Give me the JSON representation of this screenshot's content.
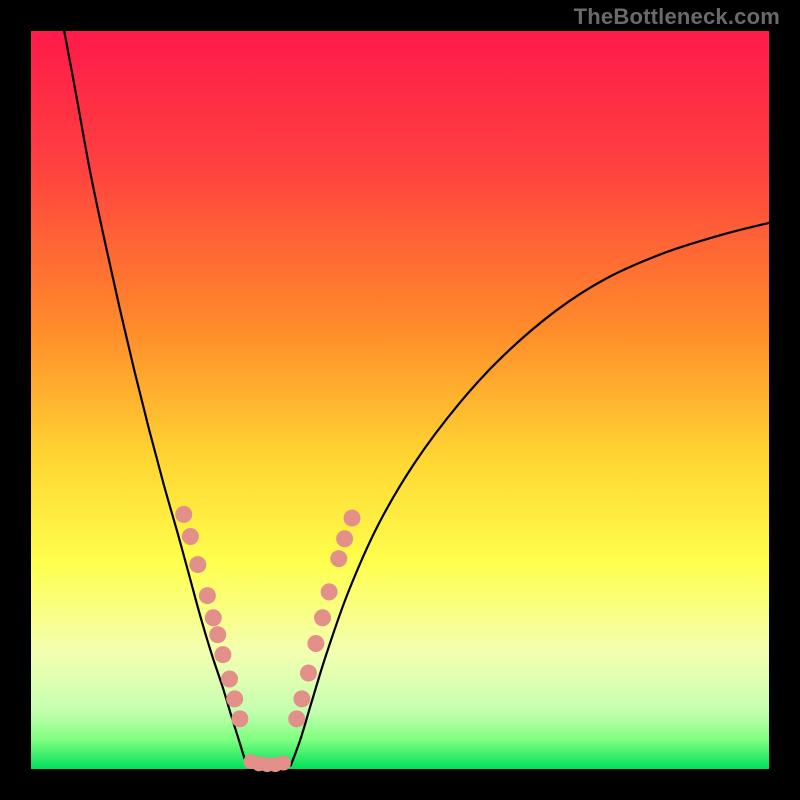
{
  "watermark": "TheBottleneck.com",
  "colors": {
    "frame": "#000000",
    "gradient_stops": [
      {
        "pct": 0,
        "color": "#ff1a4a"
      },
      {
        "pct": 18,
        "color": "#ff4040"
      },
      {
        "pct": 40,
        "color": "#ff8a2a"
      },
      {
        "pct": 58,
        "color": "#ffd633"
      },
      {
        "pct": 72,
        "color": "#ffff4d"
      },
      {
        "pct": 84,
        "color": "#f4ffb0"
      },
      {
        "pct": 92,
        "color": "#c6ffb0"
      },
      {
        "pct": 96,
        "color": "#80ff80"
      },
      {
        "pct": 100,
        "color": "#00e05a"
      }
    ],
    "curve": "#000000",
    "marker": "#e38f8a"
  },
  "chart_data": {
    "type": "line",
    "title": "",
    "xlabel": "",
    "ylabel": "",
    "x_range": [
      0,
      100
    ],
    "y_range": [
      0,
      100
    ],
    "gradient_meaning": "vertical color gradient: red (top, high bottleneck) → green (bottom, no bottleneck)",
    "series": [
      {
        "name": "left-arm",
        "x": [
          4.5,
          6,
          8,
          10,
          12,
          14,
          16,
          18,
          20,
          21.5,
          23,
          24.5,
          26,
          27.2,
          28.3,
          29.2
        ],
        "y": [
          100,
          92,
          81,
          71.5,
          62.5,
          54,
          46,
          38.5,
          31.5,
          26,
          20.5,
          15.5,
          11,
          7,
          3.5,
          0.5
        ]
      },
      {
        "name": "valley-floor",
        "x": [
          29.2,
          30.2,
          31.6,
          33.0,
          34.2,
          35.2
        ],
        "y": [
          0.5,
          0.2,
          0.15,
          0.15,
          0.2,
          0.5
        ]
      },
      {
        "name": "right-arm",
        "x": [
          35.2,
          36.5,
          38,
          40,
          43,
          47,
          52,
          58,
          64,
          71,
          78,
          86,
          94,
          100
        ],
        "y": [
          0.5,
          4,
          9,
          15.5,
          24,
          33,
          41.5,
          49.5,
          56,
          62,
          66.5,
          70,
          72.5,
          74
        ]
      }
    ],
    "markers_left": [
      {
        "x": 20.7,
        "y": 34.5
      },
      {
        "x": 21.6,
        "y": 31.5
      },
      {
        "x": 22.6,
        "y": 27.7
      },
      {
        "x": 23.9,
        "y": 23.5
      },
      {
        "x": 24.7,
        "y": 20.5
      },
      {
        "x": 25.3,
        "y": 18.2
      },
      {
        "x": 26.0,
        "y": 15.5
      },
      {
        "x": 26.9,
        "y": 12.2
      },
      {
        "x": 27.6,
        "y": 9.5
      },
      {
        "x": 28.3,
        "y": 6.8
      }
    ],
    "markers_right": [
      {
        "x": 36.0,
        "y": 6.8
      },
      {
        "x": 36.7,
        "y": 9.5
      },
      {
        "x": 37.6,
        "y": 13.0
      },
      {
        "x": 38.6,
        "y": 17.0
      },
      {
        "x": 39.5,
        "y": 20.5
      },
      {
        "x": 40.4,
        "y": 24.0
      },
      {
        "x": 41.7,
        "y": 28.5
      },
      {
        "x": 42.5,
        "y": 31.2
      },
      {
        "x": 43.5,
        "y": 34.0
      }
    ],
    "markers_floor": [
      {
        "x": 29.8,
        "y": 1.0
      },
      {
        "x": 30.9,
        "y": 0.7
      },
      {
        "x": 32.0,
        "y": 0.6
      },
      {
        "x": 33.1,
        "y": 0.6
      },
      {
        "x": 34.2,
        "y": 0.8
      }
    ]
  }
}
